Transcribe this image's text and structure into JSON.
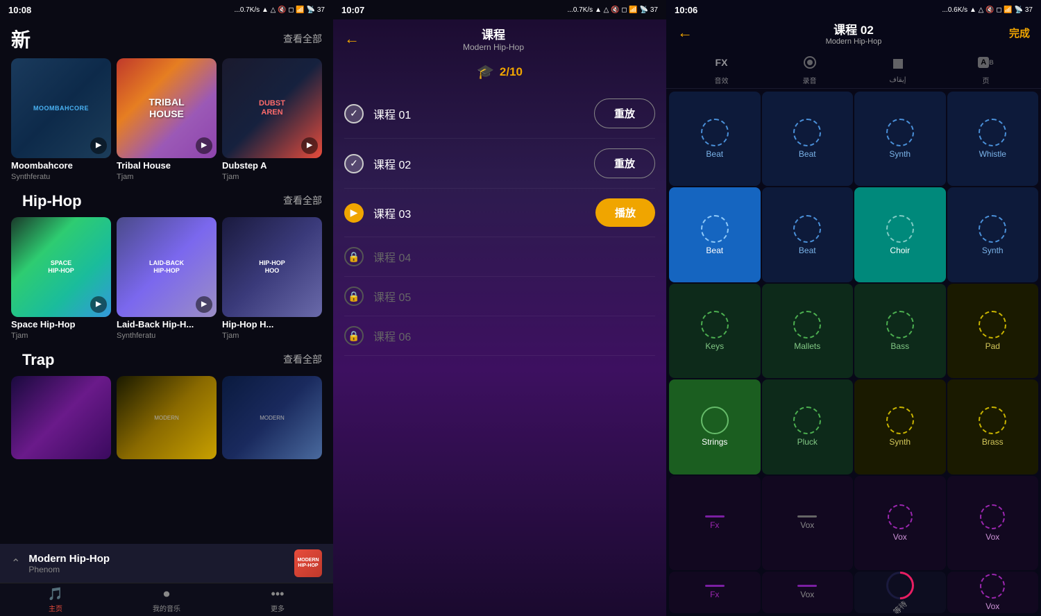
{
  "panel1": {
    "status": {
      "time": "10:08",
      "signal": "...0.7K/s",
      "battery": "37"
    },
    "header": {
      "title": "新",
      "view_all": "查看全部"
    },
    "new_section": {
      "cards": [
        {
          "name": "Moombahcore",
          "author": "Synthferatu",
          "color": "moombah"
        },
        {
          "name": "Tribal House",
          "author": "Tjam",
          "color": "tribal"
        },
        {
          "name": "Dubstep A",
          "author": "Tjam",
          "color": "dubstep"
        }
      ]
    },
    "hiphop_section": {
      "label": "Hip-Hop",
      "view_all": "查看全部",
      "cards": [
        {
          "name": "Space Hip-Hop",
          "author": "Tjam",
          "color": "space"
        },
        {
          "name": "Laid-Back Hip-H...",
          "author": "Synthferatu",
          "color": "laidback"
        },
        {
          "name": "Hip-Hop H...",
          "author": "Tjam",
          "color": "hiphop"
        }
      ]
    },
    "trap_section": {
      "label": "Trap",
      "view_all": "查看全部"
    },
    "mini_player": {
      "title": "Modern Hip-Hop",
      "subtitle": "Phenom"
    },
    "nav": [
      {
        "icon": "🎵",
        "label": "主页",
        "active": true
      },
      {
        "icon": "⏺",
        "label": "我的音乐",
        "active": false
      },
      {
        "icon": "•••",
        "label": "更多",
        "active": false
      }
    ]
  },
  "panel2": {
    "status": {
      "time": "10:07",
      "signal": "...0.7K/s",
      "battery": "37"
    },
    "header": {
      "title": "课程",
      "subtitle": "Modern Hip-Hop"
    },
    "progress": {
      "text": "2/10",
      "icon": "🎓"
    },
    "lessons": [
      {
        "id": "01",
        "name": "课程 01",
        "status": "completed",
        "btn_label": "重放"
      },
      {
        "id": "02",
        "name": "课程 02",
        "status": "completed",
        "btn_label": "重放"
      },
      {
        "id": "03",
        "name": "课程 03",
        "status": "active",
        "btn_label": "播放"
      },
      {
        "id": "04",
        "name": "课程 04",
        "status": "locked",
        "btn_label": ""
      },
      {
        "id": "05",
        "name": "课程 05",
        "status": "locked",
        "btn_label": ""
      },
      {
        "id": "06",
        "name": "课程 06",
        "status": "locked",
        "btn_label": ""
      }
    ]
  },
  "panel3": {
    "status": {
      "time": "10:06",
      "signal": "...0.6K/s",
      "battery": "37"
    },
    "header": {
      "title": "课程 02",
      "subtitle": "Modern Hip-Hop",
      "done": "完成"
    },
    "toolbar": [
      {
        "icon": "FX",
        "label": "音效",
        "active": false
      },
      {
        "icon": "⏺",
        "label": "录音",
        "active": false
      },
      {
        "icon": "■",
        "label": "إيقاف",
        "active": false
      },
      {
        "icon": "A",
        "label": "页",
        "active": false
      }
    ],
    "pads": [
      {
        "label": "Beat",
        "type": "blue",
        "row": 1
      },
      {
        "label": "Beat",
        "type": "blue",
        "row": 1
      },
      {
        "label": "Synth",
        "type": "blue",
        "row": 1
      },
      {
        "label": "Whistle",
        "type": "blue",
        "row": 1
      },
      {
        "label": "Beat",
        "type": "blue-active",
        "row": 2
      },
      {
        "label": "Beat",
        "type": "blue",
        "row": 2
      },
      {
        "label": "Choir",
        "type": "teal-active",
        "row": 2
      },
      {
        "label": "Synth",
        "type": "blue",
        "row": 2
      },
      {
        "label": "Keys",
        "type": "green-dark",
        "row": 3
      },
      {
        "label": "Mallets",
        "type": "green-dark",
        "row": 3
      },
      {
        "label": "Bass",
        "type": "green-dark",
        "row": 3
      },
      {
        "label": "Pad",
        "type": "olive",
        "row": 3
      },
      {
        "label": "Strings",
        "type": "green-bright",
        "row": 4
      },
      {
        "label": "Pluck",
        "type": "green-dark",
        "row": 4
      },
      {
        "label": "Synth",
        "type": "olive",
        "row": 4
      },
      {
        "label": "Brass",
        "type": "olive",
        "row": 4
      },
      {
        "label": "Fx",
        "type": "fx-purple",
        "row": 5
      },
      {
        "label": "Vox",
        "type": "fx-gray",
        "row": 5
      },
      {
        "label": "Vox",
        "type": "fx-teal",
        "row": 5
      },
      {
        "label": "Vox",
        "type": "vox-purple",
        "row": 5
      },
      {
        "label": "Fx",
        "type": "fx-purple-2",
        "row": 6
      },
      {
        "label": "Vox",
        "type": "fx-purple-3",
        "row": 6
      },
      {
        "label": "等待",
        "type": "loading",
        "row": 6
      },
      {
        "label": "Vox",
        "type": "vox-purple",
        "row": 6
      }
    ]
  }
}
